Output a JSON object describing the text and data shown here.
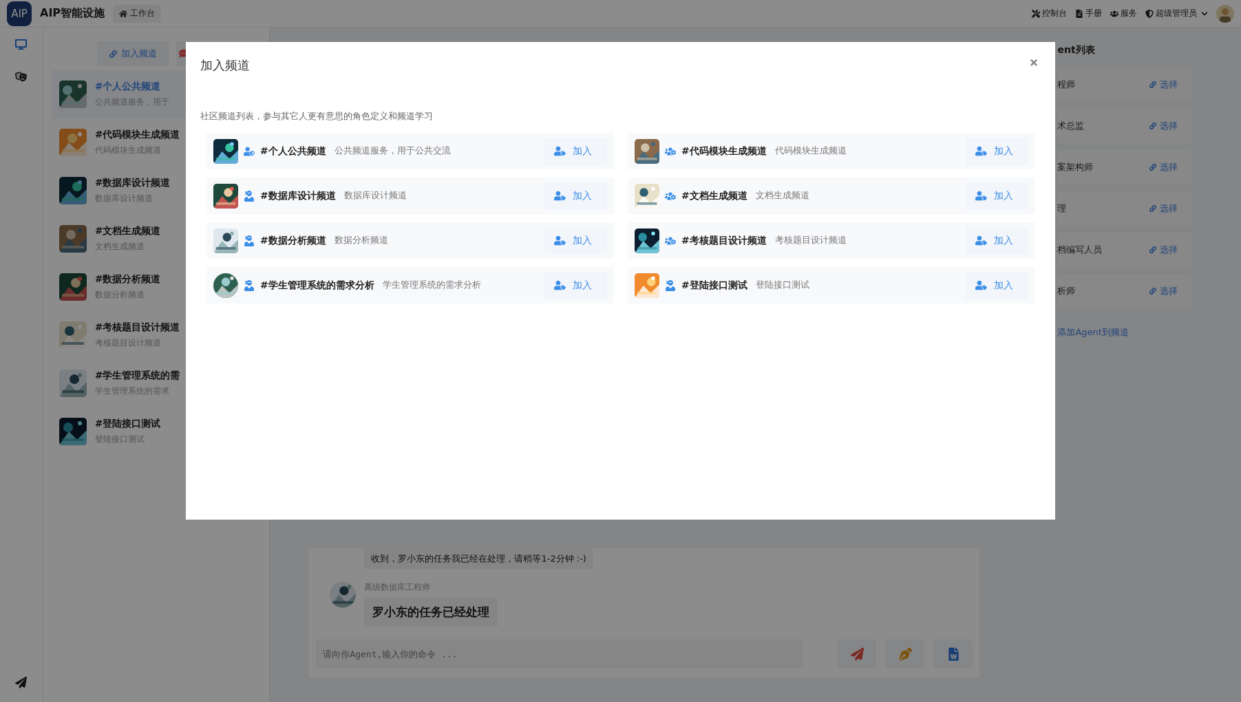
{
  "top_bar": {
    "logo": "AIP",
    "app_name": "AIP智能设施",
    "home_button": "工作台",
    "nav": [
      {
        "kind": "console",
        "label": "控制台"
      },
      {
        "kind": "manual",
        "label": "手册"
      },
      {
        "kind": "service",
        "label": "服务"
      }
    ],
    "user": {
      "label": "超级管理员"
    }
  },
  "rail": [
    {
      "kind": "monitor",
      "selected": true
    },
    {
      "kind": "masks",
      "selected": false
    },
    {
      "kind": "plane",
      "selected": false
    }
  ],
  "channel_list": {
    "join_button": "加入频道",
    "items": [
      {
        "title": "#个人公共频道",
        "desc": "公共频道服务，用于",
        "selected": true
      },
      {
        "title": "#代码模块生成频道",
        "desc": "代码模块生成频道",
        "selected": false
      },
      {
        "title": "#数据库设计频道",
        "desc": "数据库设计频道",
        "selected": false
      },
      {
        "title": "#文档生成频道",
        "desc": "文档生成频道",
        "selected": false
      },
      {
        "title": "#数据分析频道",
        "desc": "数据分析频道",
        "selected": false
      },
      {
        "title": "#考核题目设计频道",
        "desc": "考核题目设计频道",
        "selected": false
      },
      {
        "title": "#学生管理系统的需",
        "desc": "学生管理系统的需求",
        "selected": false
      },
      {
        "title": "#登陆接口测试",
        "desc": "登陆接口测试",
        "selected": false
      }
    ]
  },
  "chat": {
    "messages": [
      {
        "kind": "plain",
        "text": "收到，罗小东的任务我已经在处理，请稍等1-2分钟 :-)"
      },
      {
        "kind": "reply",
        "sender": "高级数据库工程师",
        "text": "罗小东的任务已经处理"
      }
    ],
    "input": {
      "placeholder": "请向你Agent,输入你的命令 ..."
    },
    "actions": [
      {
        "kind": "send"
      },
      {
        "kind": "pen"
      },
      {
        "kind": "word"
      }
    ]
  },
  "agents": {
    "title": "ent列表",
    "items": [
      {
        "name": "程师",
        "action": "选择"
      },
      {
        "name": "术总监",
        "action": "选择"
      },
      {
        "name": "案架构师",
        "action": "选择"
      },
      {
        "name": "理",
        "action": "选择"
      },
      {
        "name": "档编写人员",
        "action": "选择"
      },
      {
        "name": "析师",
        "action": "选择"
      }
    ],
    "add_label": "添加Agent到频道"
  },
  "dialog": {
    "title": "加入频道",
    "subtitle": "社区频道列表，参与其它人更有意思的角色定义和频道学习",
    "channels": [
      {
        "kind": "shield",
        "name": "#个人公共频道",
        "desc": "公共频道服务，用于公共交流",
        "action": "加入"
      },
      {
        "kind": "group",
        "name": "#代码模块生成频道",
        "desc": "代码模块生成频道",
        "action": "加入"
      },
      {
        "kind": "single",
        "name": "#数据库设计频道",
        "desc": "数据库设计频道",
        "action": "加入"
      },
      {
        "kind": "group",
        "name": "#文档生成频道",
        "desc": "文档生成频道",
        "action": "加入"
      },
      {
        "kind": "single",
        "name": "#数据分析频道",
        "desc": "数据分析频道",
        "action": "加入"
      },
      {
        "kind": "group",
        "name": "#考核题目设计频道",
        "desc": "考核题目设计频道",
        "action": "加入"
      },
      {
        "kind": "single",
        "name": "#学生管理系统的需求分析",
        "desc": "学生管理系统的需求分析",
        "action": "加入"
      },
      {
        "kind": "single",
        "name": "#登陆接口测试",
        "desc": "登陆接口测试",
        "action": "加入"
      }
    ]
  }
}
